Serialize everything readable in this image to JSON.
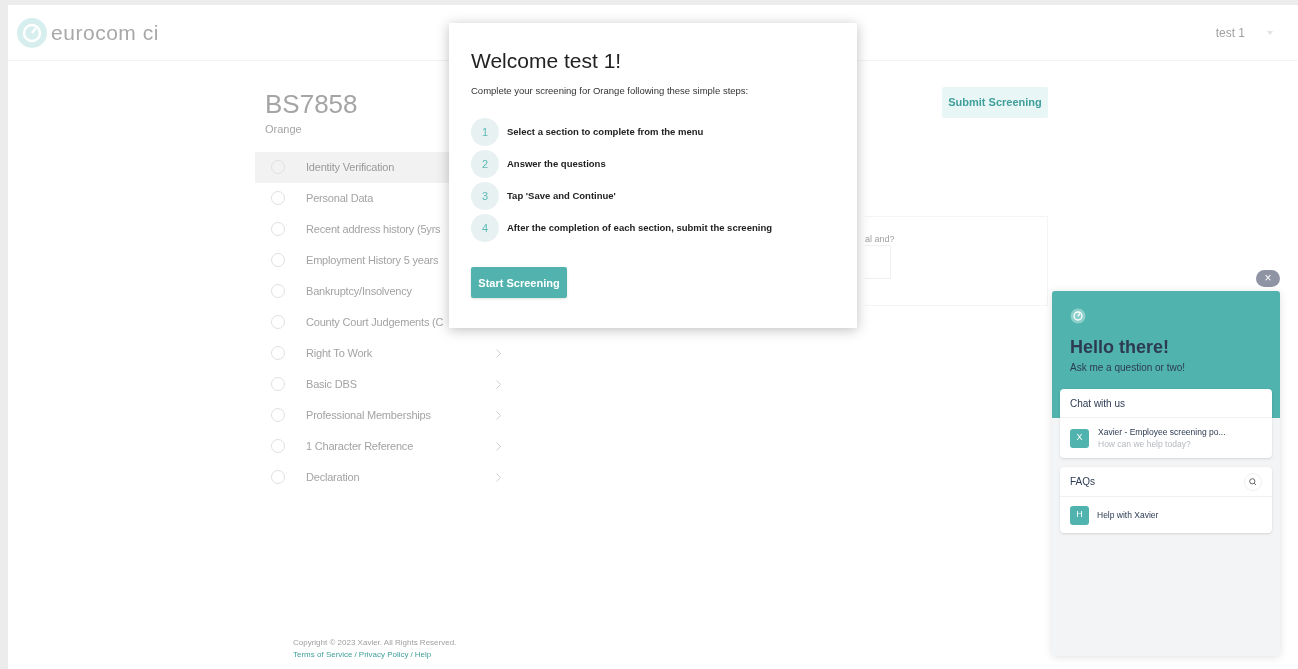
{
  "header": {
    "logo_text": "eurocom ci",
    "user": "test 1"
  },
  "screening": {
    "title": "BS7858",
    "client": "Orange",
    "submit_button": "Submit Screening"
  },
  "sections": [
    {
      "label": "Identity Verification",
      "selected": true
    },
    {
      "label": "Personal Data",
      "selected": false
    },
    {
      "label": "Recent address history (5yrs",
      "selected": false
    },
    {
      "label": "Employment History 5 years",
      "selected": false
    },
    {
      "label": "Bankruptcy/Insolvency",
      "selected": false
    },
    {
      "label": "County Court Judgements (C",
      "selected": false
    },
    {
      "label": "Right To Work",
      "selected": false,
      "chevron": true
    },
    {
      "label": "Basic DBS",
      "selected": false,
      "chevron": true
    },
    {
      "label": "Professional Memberships",
      "selected": false,
      "chevron": true
    },
    {
      "label": "1 Character Reference",
      "selected": false,
      "chevron": true
    },
    {
      "label": "Declaration",
      "selected": false,
      "chevron": true
    }
  ],
  "question_card": {
    "question": "al and?"
  },
  "footer": {
    "copyright": "Copyright © 2023 Xavier. All Rights Reserved.",
    "links": [
      "Terms of Service",
      "Privacy Policy",
      "Help"
    ],
    "separator": "/"
  },
  "modal": {
    "title": "Welcome test 1!",
    "intro": "Complete your screening for Orange following these simple steps:",
    "steps": [
      {
        "number": "1",
        "text": "Select a section to complete from the menu"
      },
      {
        "number": "2",
        "text": "Answer the questions"
      },
      {
        "number": "3",
        "text": "Tap 'Save and Continue'"
      },
      {
        "number": "4",
        "text": "After the completion of each section, submit the screening"
      }
    ],
    "button": "Start Screening"
  },
  "chat_widget": {
    "close": "×",
    "greeting": "Hello there!",
    "subtitle": "Ask me a question or two!",
    "chat_heading": "Chat with us",
    "conversation": {
      "avatar": "X",
      "name": "Xavier - Employee screening po...",
      "preview": "How can we help today?"
    },
    "faq_heading": "FAQs",
    "faqs": [
      {
        "avatar": "H",
        "title": "Help with Xavier"
      }
    ]
  }
}
